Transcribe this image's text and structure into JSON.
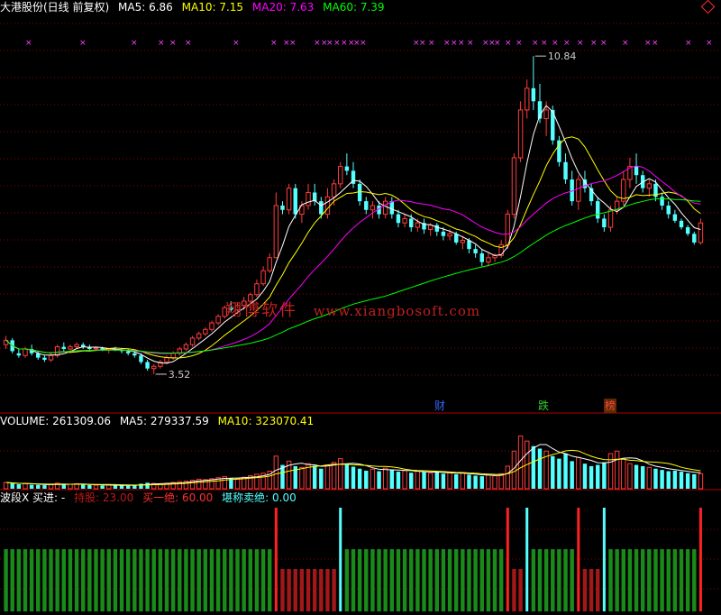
{
  "header": {
    "title": "大港股份(日线 前复权)",
    "ma5_label": "MA5: 6.86",
    "ma10_label": "MA10: 7.15",
    "ma20_label": "MA20: 7.63",
    "ma60_label": "MA60: 7.39",
    "diamond_icon": "diamond-icon"
  },
  "price_panel": {
    "high_label": "10.84",
    "low_label": "3.52",
    "marker_char": "×"
  },
  "watermark": {
    "cn": "翔博软件",
    "url": "www.xiangbosoft.com"
  },
  "events": [
    {
      "label": "财",
      "color": "#3366ff"
    },
    {
      "label": "跌",
      "color": "#33cc33"
    },
    {
      "label": "榜",
      "color": "#dd4444"
    }
  ],
  "volume_panel": {
    "volume_label": "VOLUME: 261309.06",
    "ma5_label": "MA5: 279337.59",
    "ma10_label": "MA10: 323070.41"
  },
  "indicator_panel": {
    "name_label": "波段X 买进: -",
    "hold_label": "持股: 23.00",
    "buy_label": "买一绝: 60.00",
    "sell_label": "堪称卖绝: 0.00"
  },
  "colors": {
    "up": "#ff3c3c",
    "down": "#54ffff",
    "ma5": "#ffffff",
    "ma10": "#ffff00",
    "ma20": "#ff00ff",
    "ma60": "#00ff00",
    "grid": "#8b0000",
    "hold_bar": "#1a8a1a",
    "wait_bar": "#a01818"
  },
  "chart_data": {
    "type": "candlestick",
    "symbol": "大港股份",
    "period": "日线 前复权",
    "moving_averages": {
      "MA5": 6.86,
      "MA10": 7.15,
      "MA20": 7.63,
      "MA60": 7.39
    },
    "annotated_high": 10.84,
    "annotated_low": 3.52,
    "volume": {
      "VOLUME": 261309.06,
      "MA5": 279337.59,
      "MA10": 323070.41
    },
    "indicator": {
      "持股": 23.0,
      "买一绝": 60.0,
      "堪称卖绝": 0.0
    },
    "candles": [
      [
        4.2,
        4.4,
        4.1,
        4.3
      ],
      [
        4.3,
        4.35,
        4.0,
        4.05
      ],
      [
        4.0,
        4.1,
        3.9,
        3.95
      ],
      [
        3.95,
        4.15,
        3.9,
        4.1
      ],
      [
        4.1,
        4.2,
        3.95,
        4.0
      ],
      [
        4.0,
        4.05,
        3.85,
        3.9
      ],
      [
        3.9,
        3.95,
        3.8,
        3.85
      ],
      [
        3.85,
        4.0,
        3.8,
        3.95
      ],
      [
        3.95,
        4.2,
        3.9,
        4.15
      ],
      [
        4.15,
        4.25,
        4.05,
        4.1
      ],
      [
        4.1,
        4.2,
        4.0,
        4.15
      ],
      [
        4.15,
        4.25,
        4.1,
        4.2
      ],
      [
        4.2,
        4.25,
        4.1,
        4.15
      ],
      [
        4.15,
        4.2,
        4.05,
        4.1
      ],
      [
        4.1,
        4.15,
        4.05,
        4.12
      ],
      [
        4.12,
        4.15,
        4.05,
        4.08
      ],
      [
        4.08,
        4.12,
        4.0,
        4.1
      ],
      [
        4.1,
        4.15,
        4.05,
        4.08
      ],
      [
        4.08,
        4.12,
        4.0,
        4.05
      ],
      [
        4.05,
        4.1,
        3.95,
        4.0
      ],
      [
        4.0,
        4.05,
        3.9,
        3.95
      ],
      [
        3.95,
        4.0,
        3.75,
        3.8
      ],
      [
        3.8,
        3.85,
        3.6,
        3.65
      ],
      [
        3.65,
        3.75,
        3.52,
        3.7
      ],
      [
        3.7,
        3.85,
        3.65,
        3.8
      ],
      [
        3.8,
        3.95,
        3.75,
        3.9
      ],
      [
        3.9,
        4.05,
        3.85,
        4.0
      ],
      [
        4.0,
        4.15,
        3.95,
        4.1
      ],
      [
        4.1,
        4.25,
        4.05,
        4.2
      ],
      [
        4.2,
        4.4,
        4.15,
        4.35
      ],
      [
        4.35,
        4.5,
        4.3,
        4.45
      ],
      [
        4.45,
        4.6,
        4.4,
        4.55
      ],
      [
        4.55,
        4.75,
        4.5,
        4.7
      ],
      [
        4.7,
        4.9,
        4.65,
        4.85
      ],
      [
        4.85,
        5.1,
        4.8,
        5.05
      ],
      [
        5.05,
        5.2,
        4.95,
        5.0
      ],
      [
        5.0,
        5.15,
        4.9,
        5.1
      ],
      [
        5.1,
        5.3,
        5.0,
        5.2
      ],
      [
        5.2,
        5.4,
        5.15,
        5.35
      ],
      [
        5.35,
        5.7,
        5.3,
        5.6
      ],
      [
        5.6,
        6.0,
        5.55,
        5.9
      ],
      [
        5.9,
        6.3,
        5.85,
        6.2
      ],
      [
        6.2,
        7.7,
        6.2,
        7.4
      ],
      [
        7.4,
        7.5,
        7.2,
        7.3
      ],
      [
        7.3,
        7.9,
        7.2,
        7.8
      ],
      [
        7.8,
        7.9,
        7.1,
        7.2
      ],
      [
        7.2,
        7.5,
        7.0,
        7.4
      ],
      [
        7.4,
        7.9,
        7.3,
        7.7
      ],
      [
        7.7,
        7.9,
        7.4,
        7.5
      ],
      [
        7.5,
        7.6,
        7.1,
        7.2
      ],
      [
        7.2,
        7.8,
        7.1,
        7.6
      ],
      [
        7.6,
        8.0,
        7.4,
        7.9
      ],
      [
        7.9,
        8.4,
        7.8,
        8.3
      ],
      [
        8.3,
        8.6,
        8.1,
        8.2
      ],
      [
        8.2,
        8.4,
        7.8,
        7.9
      ],
      [
        7.9,
        8.0,
        7.4,
        7.5
      ],
      [
        7.5,
        7.6,
        7.2,
        7.3
      ],
      [
        7.3,
        7.5,
        7.1,
        7.4
      ],
      [
        7.4,
        7.5,
        7.1,
        7.2
      ],
      [
        7.2,
        7.6,
        7.1,
        7.5
      ],
      [
        7.5,
        7.6,
        7.1,
        7.2
      ],
      [
        7.2,
        7.3,
        6.9,
        7.0
      ],
      [
        7.0,
        7.2,
        6.9,
        7.1
      ],
      [
        7.1,
        7.2,
        6.8,
        6.9
      ],
      [
        6.9,
        7.1,
        6.8,
        7.0
      ],
      [
        7.0,
        7.1,
        6.75,
        6.85
      ],
      [
        6.85,
        7.0,
        6.7,
        6.95
      ],
      [
        6.95,
        7.0,
        6.7,
        6.8
      ],
      [
        6.8,
        6.9,
        6.6,
        6.7
      ],
      [
        6.7,
        6.85,
        6.6,
        6.75
      ],
      [
        6.75,
        6.8,
        6.5,
        6.55
      ],
      [
        6.55,
        6.7,
        6.4,
        6.6
      ],
      [
        6.6,
        6.65,
        6.3,
        6.4
      ],
      [
        6.4,
        6.5,
        6.2,
        6.3
      ],
      [
        6.3,
        6.4,
        6.0,
        6.1
      ],
      [
        6.1,
        6.3,
        6.0,
        6.2
      ],
      [
        6.2,
        6.3,
        6.1,
        6.25
      ],
      [
        6.25,
        6.6,
        6.2,
        6.5
      ],
      [
        6.5,
        7.3,
        6.4,
        7.2
      ],
      [
        7.2,
        8.6,
        7.1,
        8.5
      ],
      [
        8.5,
        9.8,
        8.4,
        9.6
      ],
      [
        9.6,
        10.3,
        9.4,
        10.1
      ],
      [
        10.1,
        10.84,
        9.6,
        9.8
      ],
      [
        9.8,
        10.2,
        9.3,
        9.4
      ],
      [
        9.4,
        9.8,
        9.0,
        9.6
      ],
      [
        9.6,
        9.7,
        8.8,
        8.9
      ],
      [
        8.9,
        9.0,
        8.3,
        8.4
      ],
      [
        8.4,
        8.6,
        7.9,
        8.0
      ],
      [
        8.0,
        8.2,
        7.4,
        7.5
      ],
      [
        7.5,
        8.1,
        7.3,
        8.0
      ],
      [
        8.0,
        8.2,
        7.7,
        7.8
      ],
      [
        7.8,
        7.9,
        7.4,
        7.5
      ],
      [
        7.5,
        7.6,
        7.0,
        7.1
      ],
      [
        7.1,
        7.2,
        6.8,
        6.9
      ],
      [
        6.9,
        7.4,
        6.8,
        7.3
      ],
      [
        7.3,
        7.6,
        7.2,
        7.5
      ],
      [
        7.5,
        8.2,
        7.4,
        8.0
      ],
      [
        8.0,
        8.5,
        7.8,
        8.3
      ],
      [
        8.3,
        8.6,
        7.9,
        8.1
      ],
      [
        8.1,
        8.2,
        7.7,
        7.8
      ],
      [
        7.8,
        8.0,
        7.6,
        7.9
      ],
      [
        7.9,
        8.0,
        7.5,
        7.6
      ],
      [
        7.6,
        7.7,
        7.3,
        7.4
      ],
      [
        7.4,
        7.5,
        7.1,
        7.2
      ],
      [
        7.2,
        7.3,
        7.0,
        7.05
      ],
      [
        7.05,
        7.1,
        6.85,
        6.9
      ],
      [
        6.9,
        6.95,
        6.7,
        6.75
      ],
      [
        6.75,
        6.8,
        6.5,
        6.55
      ],
      [
        6.55,
        7.1,
        6.5,
        7.0
      ]
    ],
    "volumes": [
      25,
      22,
      18,
      20,
      16,
      15,
      14,
      17,
      22,
      19,
      18,
      20,
      16,
      15,
      14,
      13,
      15,
      14,
      13,
      12,
      16,
      20,
      24,
      21,
      19,
      22,
      25,
      28,
      30,
      34,
      38,
      36,
      40,
      44,
      48,
      42,
      40,
      46,
      52,
      58,
      62,
      70,
      130,
      95,
      110,
      90,
      85,
      100,
      92,
      80,
      95,
      105,
      120,
      100,
      88,
      80,
      72,
      78,
      70,
      82,
      75,
      68,
      72,
      64,
      70,
      66,
      62,
      68,
      60,
      64,
      58,
      62,
      56,
      52,
      50,
      54,
      52,
      60,
      90,
      150,
      210,
      190,
      170,
      160,
      150,
      130,
      120,
      140,
      110,
      125,
      100,
      90,
      95,
      105,
      140,
      150,
      120,
      100,
      95,
      90,
      85,
      80,
      75,
      70,
      72,
      68,
      62,
      58,
      60
    ],
    "indicator_states": "hold_then_wait_sequence"
  }
}
